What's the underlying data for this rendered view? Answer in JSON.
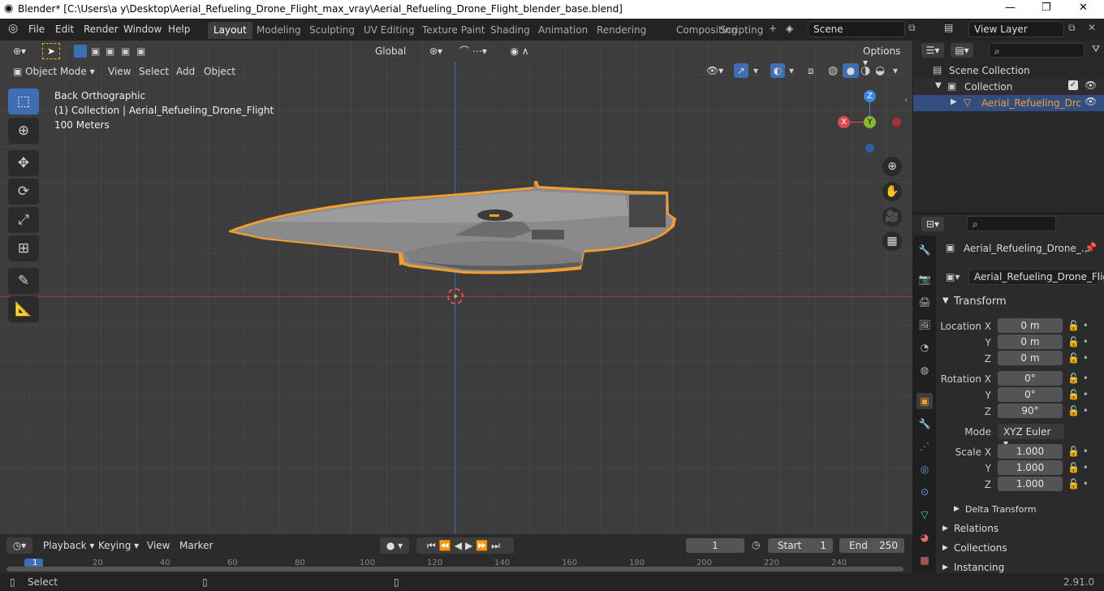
{
  "window": {
    "title": "Blender* [C:\\Users\\a y\\Desktop\\Aerial_Refueling_Drone_Flight_max_vray\\Aerial_Refueling_Drone_Flight_blender_base.blend]",
    "minimize": "—",
    "maximize": "❐",
    "close": "✕"
  },
  "menu": {
    "file": "File",
    "edit": "Edit",
    "render": "Render",
    "window": "Window",
    "help": "Help"
  },
  "workspaces": [
    "Layout",
    "Modeling",
    "Sculpting",
    "UV Editing",
    "Texture Paint",
    "Shading",
    "Animation",
    "Rendering",
    "Compositing",
    "Scripting"
  ],
  "scene": {
    "name": "Scene",
    "view_layer": "View Layer"
  },
  "header": {
    "transform_orientation": "Global",
    "options": "Options",
    "mode": "Object Mode",
    "view": "View",
    "select": "Select",
    "add": "Add",
    "object": "Object"
  },
  "overlay": {
    "line1": "Back Orthographic",
    "line2": "(1) Collection | Aerial_Refueling_Drone_Flight",
    "line3": "100 Meters"
  },
  "gizmo": {
    "x": "X",
    "y": "Y",
    "z": "Z"
  },
  "outliner": {
    "scene_collection": "Scene Collection",
    "collection": "Collection",
    "object": "Aerial_Refueling_Drc"
  },
  "properties": {
    "object_name": "Aerial_Refueling_Drone_...",
    "data_name": "Aerial_Refueling_Drone_Flight",
    "transform": "Transform",
    "location_x_label": "Location X",
    "location_x": "0 m",
    "location_y_label": "Y",
    "location_y": "0 m",
    "location_z_label": "Z",
    "location_z": "0 m",
    "rotation_x_label": "Rotation X",
    "rotation_x": "0°",
    "rotation_y_label": "Y",
    "rotation_y": "0°",
    "rotation_z_label": "Z",
    "rotation_z": "90°",
    "mode_label": "Mode",
    "mode": "XYZ Euler",
    "scale_x_label": "Scale X",
    "scale_x": "1.000",
    "scale_y_label": "Y",
    "scale_y": "1.000",
    "scale_z_label": "Z",
    "scale_z": "1.000",
    "delta": "Delta Transform",
    "relations": "Relations",
    "collections": "Collections",
    "instancing": "Instancing"
  },
  "timeline": {
    "playback": "Playback",
    "keying": "Keying",
    "view": "View",
    "marker": "Marker",
    "current_frame": "1",
    "start_label": "Start",
    "start": "1",
    "end_label": "End",
    "end": "250",
    "ruler": [
      "1",
      "20",
      "40",
      "60",
      "80",
      "100",
      "120",
      "140",
      "160",
      "180",
      "200",
      "220",
      "240"
    ]
  },
  "status": {
    "select": "Select",
    "version": "2.91.0"
  },
  "colors": {
    "accent": "#3f6fb2",
    "selection_outline": "#f59d2d",
    "x_axis": "#e0484f",
    "y_axis": "#8ab631",
    "z_axis": "#3a86e0"
  }
}
